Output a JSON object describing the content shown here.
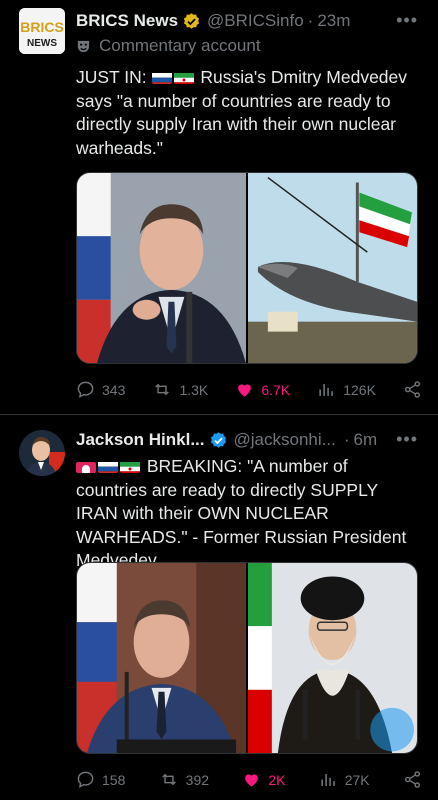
{
  "posts": [
    {
      "name": "BRICS News",
      "handle": "@BRICSinfo",
      "time": "23m",
      "commentary": "Commentary account",
      "prefix": "JUST IN:",
      "text": "Russia's Dmitry Medvedev says \"a number of countries are ready to directly supply Iran with their own nuclear warheads.\"",
      "avatar_text_top": "BRICS",
      "avatar_text_bottom": "NEWS",
      "stats": {
        "replies": "343",
        "reposts": "1.3K",
        "likes": "6.7K",
        "views": "126K"
      }
    },
    {
      "name": "Jackson Hinkl...",
      "handle": "@jacksonhi...",
      "time": "6m",
      "prefix": "BREAKING:",
      "text": "\"A number of countries are ready to directly SUPPLY IRAN with their OWN NUCLEAR WARHEADS.\" - Former Russian President Medvedev",
      "stats": {
        "replies": "158",
        "reposts": "392",
        "likes": "2K",
        "views": "27K"
      }
    }
  ],
  "colors": {
    "like": "#f91880",
    "verified_gold": "#e2b719",
    "verified_blue": "#1d9bf0",
    "muted": "#71767b"
  }
}
